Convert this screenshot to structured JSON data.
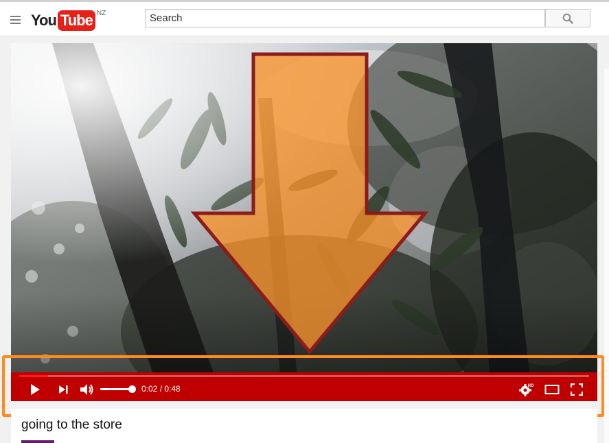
{
  "header": {
    "logo_you": "You",
    "logo_tube": "Tube",
    "logo_region": "NZ",
    "search_placeholder": "Search",
    "menu_icon": "hamburger-menu-icon",
    "search_icon": "search-icon"
  },
  "player": {
    "current_time": "0:02",
    "duration": "0:48",
    "time_display": "0:02 / 0:48",
    "progress_fraction": 0.051,
    "volume_fraction": 1.0,
    "settings_badge": "HD",
    "icons": {
      "play": "play-icon",
      "next": "next-icon",
      "volume": "volume-icon",
      "settings": "settings-gear-icon",
      "theater": "theater-mode-icon",
      "fullscreen": "fullscreen-icon"
    }
  },
  "video": {
    "title": "going to the store"
  },
  "annotation": {
    "arrow_color": "#f7922a",
    "arrow_outline": "#8b1c1c",
    "highlight_color": "#ff8a1f"
  },
  "colors": {
    "control_bar": "#c00000",
    "progress": "#ff1a1a",
    "logo_red": "#e62117"
  }
}
